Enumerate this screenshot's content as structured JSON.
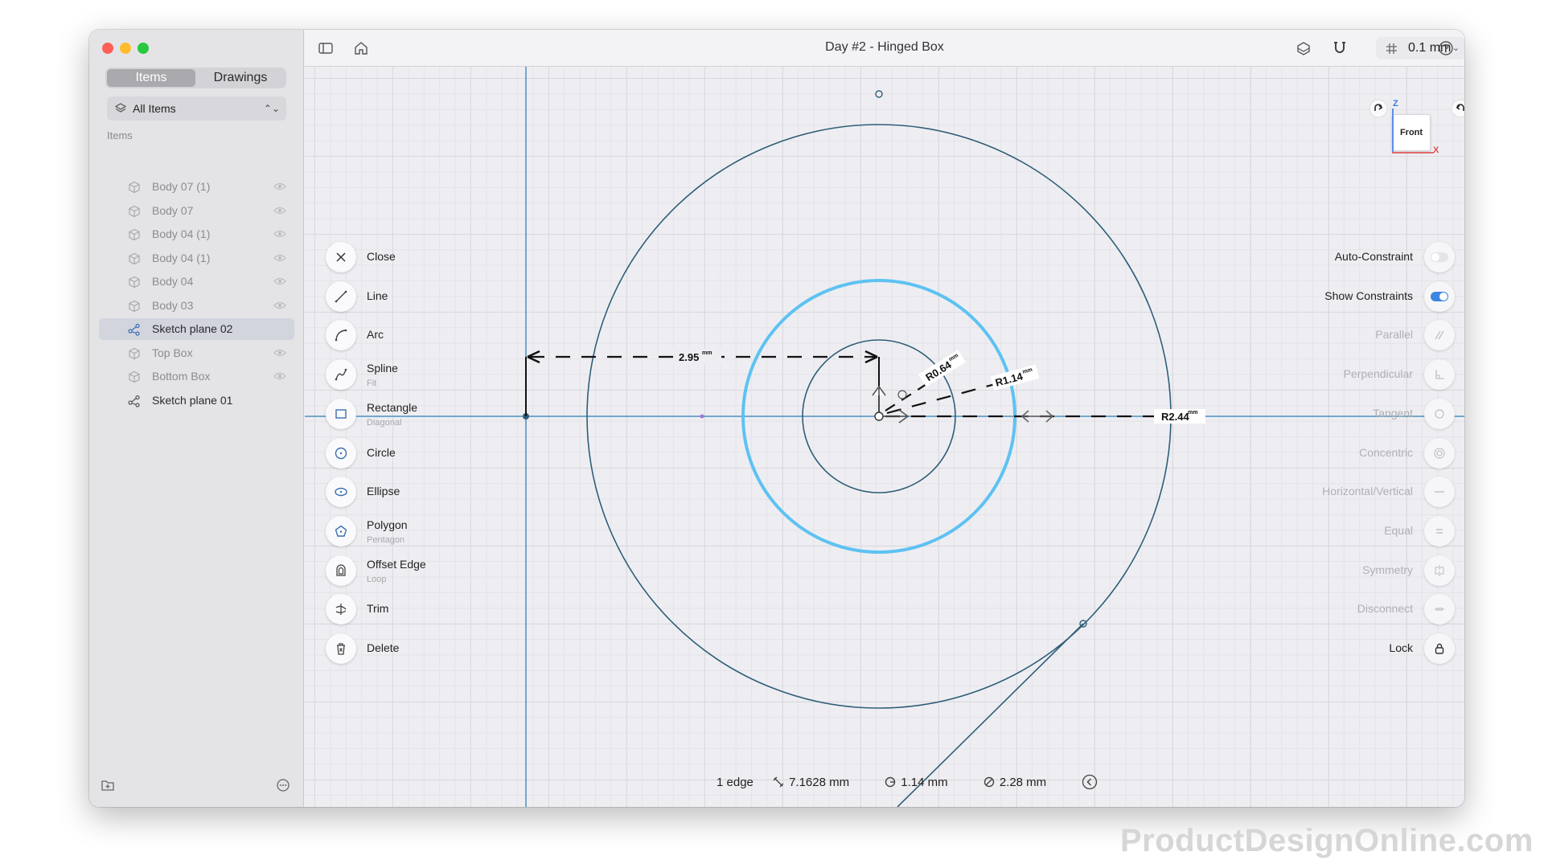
{
  "window": {
    "title": "Day #2 - Hinged Box",
    "traffic_colors": [
      "#ff5f57",
      "#febc2e",
      "#28c840"
    ]
  },
  "sidebar": {
    "tabs": [
      {
        "label": "Items",
        "active": true
      },
      {
        "label": "Drawings",
        "active": false
      }
    ],
    "filter": {
      "label": "All Items"
    },
    "section_label": "Items",
    "items": [
      {
        "label": "Body 07 (1)",
        "type": "body",
        "visible": true
      },
      {
        "label": "Body 07",
        "type": "body",
        "visible": true
      },
      {
        "label": "Body 04 (1)",
        "type": "body",
        "visible": true
      },
      {
        "label": "Body 04 (1)",
        "type": "body",
        "visible": true
      },
      {
        "label": "Body 04",
        "type": "body",
        "visible": true
      },
      {
        "label": "Body 03",
        "type": "body",
        "visible": true
      },
      {
        "label": "Sketch plane 02",
        "type": "sketch",
        "selected": true
      },
      {
        "label": "Top Box",
        "type": "body",
        "visible": true
      },
      {
        "label": "Bottom Box",
        "type": "body",
        "visible": true
      },
      {
        "label": "Sketch plane 01",
        "type": "sketch"
      }
    ]
  },
  "toolbar": {
    "grid_snap": "0.1 mm"
  },
  "tools": [
    {
      "label": "Close",
      "sub": "",
      "icon": "close-icon"
    },
    {
      "label": "Line",
      "sub": "",
      "icon": "line-icon"
    },
    {
      "label": "Arc",
      "sub": "",
      "icon": "arc-icon"
    },
    {
      "label": "Spline",
      "sub": "Fit",
      "icon": "spline-icon"
    },
    {
      "label": "Rectangle",
      "sub": "Diagonal",
      "icon": "rectangle-icon"
    },
    {
      "label": "Circle",
      "sub": "",
      "icon": "circle-icon"
    },
    {
      "label": "Ellipse",
      "sub": "",
      "icon": "ellipse-icon"
    },
    {
      "label": "Polygon",
      "sub": "Pentagon",
      "icon": "polygon-icon"
    },
    {
      "label": "Offset Edge",
      "sub": "Loop",
      "icon": "offset-edge-icon"
    },
    {
      "label": "Trim",
      "sub": "",
      "icon": "trim-icon"
    },
    {
      "label": "Delete",
      "sub": "",
      "icon": "delete-icon"
    }
  ],
  "constraints": [
    {
      "label": "Auto-Constraint",
      "enabled": true,
      "kind": "toggle",
      "on": false
    },
    {
      "label": "Show Constraints",
      "enabled": true,
      "kind": "toggle",
      "on": true
    },
    {
      "label": "Parallel",
      "enabled": false,
      "icon": "parallel-icon"
    },
    {
      "label": "Perpendicular",
      "enabled": false,
      "icon": "perpendicular-icon"
    },
    {
      "label": "Tangent",
      "enabled": false,
      "icon": "tangent-icon"
    },
    {
      "label": "Concentric",
      "enabled": false,
      "icon": "concentric-icon"
    },
    {
      "label": "Horizontal/Vertical",
      "enabled": false,
      "icon": "horizontal-vertical-icon"
    },
    {
      "label": "Equal",
      "enabled": false,
      "icon": "equal-icon"
    },
    {
      "label": "Symmetry",
      "enabled": false,
      "icon": "symmetry-icon"
    },
    {
      "label": "Disconnect",
      "enabled": false,
      "icon": "disconnect-icon"
    },
    {
      "label": "Lock",
      "enabled": true,
      "icon": "lock-icon"
    }
  ],
  "viewcube": {
    "face": "Front",
    "axis_z": "Z",
    "axis_x": "X"
  },
  "dimensions": {
    "horizontal": "2.95",
    "radius_small": "R0.64",
    "radius_mid": "R1.14",
    "radius_large": "R2.44",
    "unit": "mm"
  },
  "status": {
    "selection": "1 edge",
    "length": "7.1628 mm",
    "radius": "1.14 mm",
    "diameter": "2.28 mm"
  },
  "watermark": "ProductDesignOnline.com",
  "colors": {
    "selected_circle": "#5ec2f2",
    "sketch_line": "#2f5e78",
    "axis": "#4a8fbf",
    "toggle_on": "#3a86e0"
  }
}
